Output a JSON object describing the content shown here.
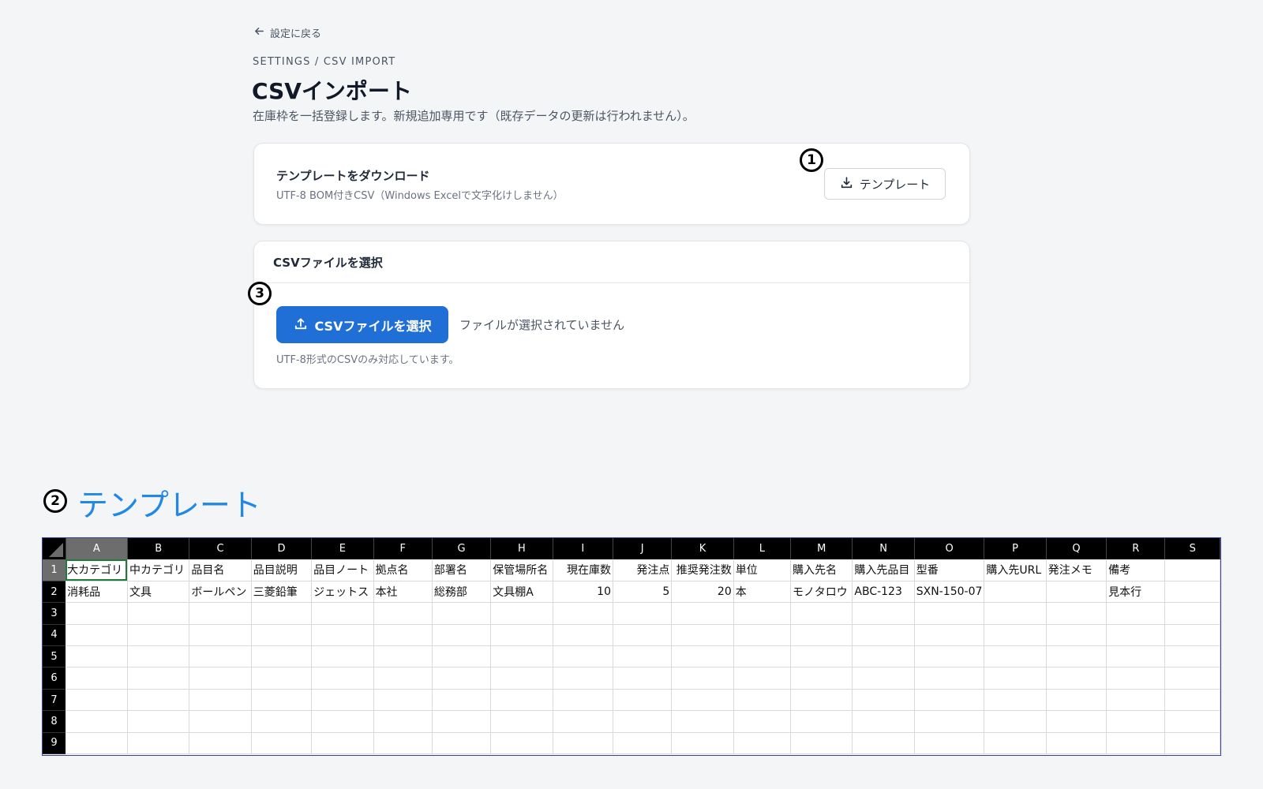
{
  "back_link": {
    "label": "設定に戻る",
    "icon": "arrow-left-icon"
  },
  "breadcrumb": "SETTINGS / CSV IMPORT",
  "page": {
    "title": "CSVインポート",
    "description": "在庫枠を一括登録します。新規追加専用です（既存データの更新は行われません）。"
  },
  "template_card": {
    "title": "テンプレートをダウンロード",
    "subtitle": "UTF-8 BOM付きCSV（Windows Excelで文字化けしません）",
    "button_label": "テンプレート",
    "button_icon": "download-icon"
  },
  "file_card": {
    "header": "CSVファイルを選択",
    "button_label": "CSVファイルを選択",
    "button_icon": "upload-icon",
    "status": "ファイルが選択されていません",
    "note": "UTF-8形式のCSVのみ対応しています。"
  },
  "markers": {
    "one": "1",
    "two": "2",
    "three": "3"
  },
  "template_heading": "テンプレート",
  "colors": {
    "accent": "#1f6fd6",
    "heading": "#2188e8",
    "background": "#f4f5f7"
  },
  "sheet": {
    "columns": [
      "A",
      "B",
      "C",
      "D",
      "E",
      "F",
      "G",
      "H",
      "I",
      "J",
      "K",
      "L",
      "M",
      "N",
      "O",
      "P",
      "Q",
      "R",
      "S"
    ],
    "row_numbers": [
      "1",
      "2",
      "3",
      "4",
      "5",
      "6",
      "7",
      "8",
      "9"
    ],
    "rows": [
      [
        "大カテゴリ",
        "中カテゴリ",
        "品目名",
        "品目説明",
        "品目ノート",
        "拠点名",
        "部署名",
        "保管場所名",
        "現在庫数",
        "発注点",
        "推奨発注数",
        "単位",
        "購入先名",
        "購入先品目",
        "型番",
        "購入先URL",
        "発注メモ",
        "備考",
        ""
      ],
      [
        "消耗品",
        "文具",
        "ボールペン",
        "三菱鉛筆",
        "ジェットス",
        "本社",
        "総務部",
        "文具棚A",
        "10",
        "5",
        "20",
        "本",
        "モノタロウ",
        "ABC-123",
        "SXN-150-07",
        "",
        "",
        "見本行",
        ""
      ]
    ]
  }
}
